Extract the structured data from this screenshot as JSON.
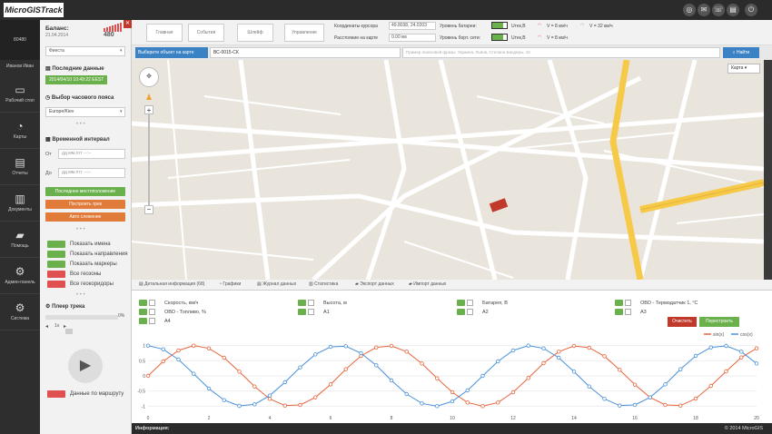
{
  "app": {
    "title": "MicroGISTrack"
  },
  "topbar": {
    "icons": [
      "support-icon",
      "mail-icon",
      "phone-icon",
      "contacts-icon",
      "power-icon"
    ]
  },
  "user": {
    "id": "80480",
    "name": "Иванов Иван"
  },
  "nav": [
    {
      "label": "Рабочий стол",
      "icon": "▭",
      "name": "desktop"
    },
    {
      "label": "Карты",
      "icon": "◔",
      "name": "maps"
    },
    {
      "label": "Отчеты",
      "icon": "▤",
      "name": "reports"
    },
    {
      "label": "Документы",
      "icon": "▥",
      "name": "documents"
    },
    {
      "label": "Помощь",
      "icon": "▰",
      "name": "help"
    },
    {
      "label": "Админ-панель",
      "icon": "⚙",
      "name": "admin"
    },
    {
      "label": "Система",
      "icon": "⚙",
      "name": "system"
    }
  ],
  "balance": {
    "label": "Баланс:",
    "date": "21.04.2014",
    "value": "480"
  },
  "vehicle": {
    "select": "Фиеста"
  },
  "last_data": {
    "title": "Последние данные",
    "value": "2014/04/10 10:49:22 EEST"
  },
  "timezone": {
    "title": "Выбор часового пояса",
    "value": "Europe/Kiev"
  },
  "interval": {
    "title": "Временной интервал",
    "from_label": "От",
    "to_label": "До",
    "placeholder": "дд.мм.гггг --:--"
  },
  "buttons": {
    "last_location": "Последнее местоположение",
    "build_track": "Построить трек",
    "auto_tracking": "Авто слежение"
  },
  "toggles": [
    {
      "label": "Показать имена",
      "state": "on"
    },
    {
      "label": "Показать направления",
      "state": "on"
    },
    {
      "label": "Показать маркеры",
      "state": "on"
    },
    {
      "label": "Все геозоны",
      "state": "off"
    },
    {
      "label": "Все геокоридоры",
      "state": "off"
    }
  ],
  "player": {
    "title": "Плеер трека",
    "progress": "0%",
    "speed": "1x",
    "by_route": "Данные по маршруту"
  },
  "toolbar": {
    "tabs": [
      "Главная",
      "События",
      "Шлейф",
      "Управление"
    ],
    "coords_label": "Координаты курсора",
    "coords_value": "49.8038, 24.0203",
    "distance_label": "Расстояние на карте",
    "distance_value": "0.00 км",
    "battery_label": "Уровень батареи:",
    "board_label": "Уровень борт. сети:",
    "battery_v": "Uтек,В",
    "board_v": "Uтек,В",
    "v1": "V = 8 км/ч",
    "v2": "V = 32 км/ч",
    "v3": "V = 8 км/ч"
  },
  "selector": {
    "select": "Выберите объект на карте",
    "object": "ВС-0015-СК",
    "search_placeholder": "Пример поисковой фразы: Украина, Львов, Степана Бандеры, 16",
    "find": "Найти"
  },
  "map": {
    "type": "Карта"
  },
  "map_tabs": [
    "Детальная информация (68)",
    "Графики",
    "Журнал данных",
    "Статистика",
    "Экспорт данных",
    "Импорт данных"
  ],
  "metrics": [
    {
      "label": "Скорость, км/ч"
    },
    {
      "label": "Высота, м"
    },
    {
      "label": "Батарея, В"
    },
    {
      "label": "OBD - Термодатчик 1, °C"
    },
    {
      "label": "OBD - Топливо, %"
    },
    {
      "label": "A1"
    },
    {
      "label": "A2"
    },
    {
      "label": "A3"
    },
    {
      "label": "A4"
    }
  ],
  "chart_actions": {
    "clear": "Очистить",
    "rebuild": "Перестроить"
  },
  "footer": {
    "info": "Информация:",
    "copyright": "© 2014 MicroGIS"
  },
  "colors": {
    "accent_green": "#6ab04c",
    "accent_orange": "#e07b39",
    "accent_blue": "#3b82c4",
    "topbar": "#2b2b2b"
  },
  "chart_data": {
    "type": "line",
    "x": [
      0,
      0.5,
      1,
      1.5,
      2,
      2.5,
      3,
      3.5,
      4,
      4.5,
      5,
      5.5,
      6,
      6.5,
      7,
      7.5,
      8,
      8.5,
      9,
      9.5,
      10,
      10.5,
      11,
      11.5,
      12,
      12.5,
      13,
      13.5,
      14,
      14.5,
      15,
      15.5,
      16,
      16.5,
      17,
      17.5,
      18,
      18.5,
      19,
      19.5,
      20
    ],
    "series": [
      {
        "name": "sin(x)",
        "color": "#e8643c",
        "values": [
          0,
          0.48,
          0.84,
          1.0,
          0.91,
          0.6,
          0.14,
          -0.35,
          -0.76,
          -0.98,
          -0.96,
          -0.71,
          -0.28,
          0.22,
          0.66,
          0.94,
          0.99,
          0.8,
          0.41,
          -0.08,
          -0.54,
          -0.88,
          -1.0,
          -0.88,
          -0.54,
          -0.07,
          0.42,
          0.8,
          0.99,
          0.93,
          0.65,
          0.2,
          -0.29,
          -0.71,
          -0.96,
          -0.98,
          -0.75,
          -0.33,
          0.15,
          0.61,
          0.91
        ]
      },
      {
        "name": "cos(x)",
        "color": "#4a90d9",
        "values": [
          1.0,
          0.88,
          0.54,
          0.07,
          -0.42,
          -0.8,
          -0.99,
          -0.94,
          -0.65,
          -0.21,
          0.28,
          0.71,
          0.96,
          0.98,
          0.75,
          0.35,
          -0.15,
          -0.6,
          -0.91,
          -1.0,
          -0.84,
          -0.48,
          0.0,
          0.48,
          0.84,
          1.0,
          0.91,
          0.6,
          0.14,
          -0.35,
          -0.76,
          -0.98,
          -0.96,
          -0.71,
          -0.28,
          0.22,
          0.66,
          0.94,
          0.99,
          0.8,
          0.41
        ]
      }
    ],
    "xticks": [
      0,
      2,
      4,
      6,
      8,
      10,
      12,
      14,
      16,
      18,
      20
    ],
    "yticks": [
      -1.0,
      -0.5,
      0.0,
      0.5,
      1.0
    ],
    "ylim": [
      -1.2,
      1.2
    ],
    "xlim": [
      0,
      20
    ],
    "legend": "top-right"
  }
}
